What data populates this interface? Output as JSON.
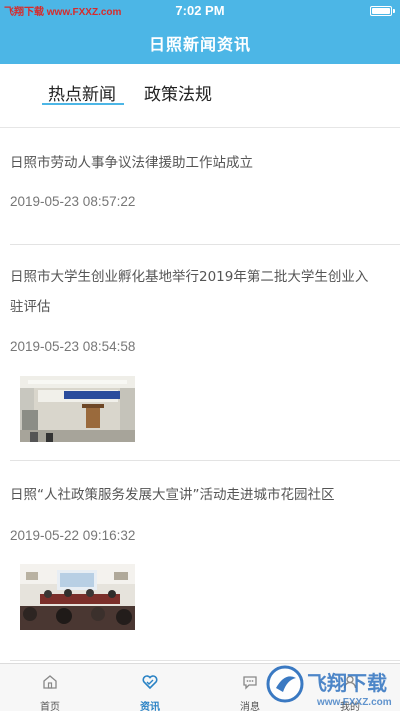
{
  "status_bar": {
    "time": "7:02 PM",
    "watermark": "飞翔下载 www.FXXZ.com"
  },
  "header": {
    "title": "日照新闻资讯"
  },
  "tabs": [
    {
      "label": "热点新闻",
      "active": true
    },
    {
      "label": "政策法规",
      "active": false
    }
  ],
  "news": [
    {
      "title": "日照市劳动人事争议法律援助工作站成立",
      "time": "2019-05-23 08:57:22"
    },
    {
      "title": "日照市大学生创业孵化基地举行2019年第二批大学生创业入驻评估",
      "time": "2019-05-23 08:54:58"
    },
    {
      "title": "日照“人社政策服务发展大宣讲”活动走进城市花园社区",
      "time": "2019-05-22 09:16:32"
    }
  ],
  "tabbar": [
    {
      "label": "首页",
      "icon": "home-icon"
    },
    {
      "label": "资讯",
      "icon": "news-heart-icon",
      "active": true
    },
    {
      "label": "消息",
      "icon": "message-icon"
    },
    {
      "label": "我的",
      "icon": "profile-icon"
    }
  ],
  "watermark_bottom": {
    "brand": "飞翔下载",
    "url": "www.FXXZ.com"
  },
  "colors": {
    "header": "#4cb6e6",
    "accent": "#2b83c5"
  }
}
